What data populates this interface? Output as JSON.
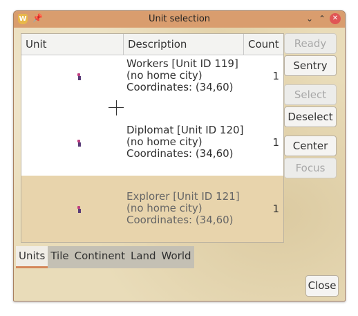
{
  "window": {
    "title": "Unit selection",
    "app_icon": "freeciv-logo-icon",
    "app_icon_glyph": "W"
  },
  "titlebar_buttons": {
    "pin": "📌",
    "minimize": "⌄",
    "maximize": "⌃",
    "close": "✕"
  },
  "table": {
    "columns": [
      "Unit",
      "Description",
      "Count"
    ],
    "rows": [
      {
        "description": "Workers [Unit ID 119]\n(no home city)\nCoordinates: (34,60)",
        "count": "1",
        "selected": false
      },
      {
        "description": "Diplomat [Unit ID 120]\n(no home city)\nCoordinates: (34,60)",
        "count": "1",
        "selected": false
      },
      {
        "description": "Explorer [Unit ID 121]\n(no home city)\nCoordinates: (34,60)",
        "count": "1",
        "selected": true
      }
    ]
  },
  "actions": {
    "ready": "Ready",
    "sentry": "Sentry",
    "select": "Select",
    "deselect": "Deselect",
    "center": "Center",
    "focus": "Focus"
  },
  "tabs": [
    "Units",
    "Tile",
    "Continent",
    "Land",
    "World"
  ],
  "active_tab": "Units",
  "close_label": "Close",
  "colors": {
    "titlebar": "#d99d6e",
    "selected_row": "#e8d4ac",
    "tab_accent": "#d4875a",
    "close_button": "#e05555"
  }
}
